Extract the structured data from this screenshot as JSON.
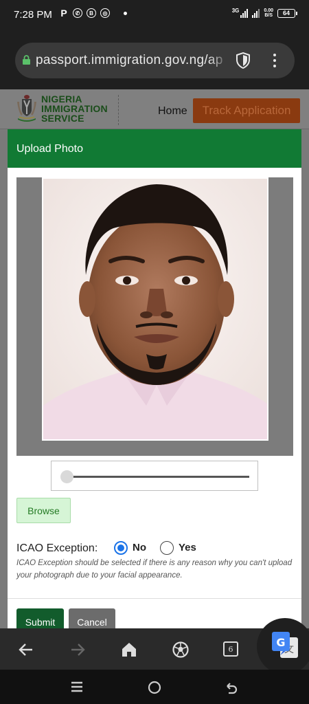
{
  "status_bar": {
    "time": "7:28 PM",
    "notification_icons": [
      "paypal-icon",
      "whatsapp-icon",
      "b-icon",
      "chrome-icon"
    ],
    "network_label": "3G",
    "speed_value": "0.00",
    "speed_unit": "B/S",
    "battery": "64"
  },
  "browser": {
    "url": "passport.immigration.gov.ng/ap",
    "tabs_count": "6"
  },
  "site": {
    "logo_line1": "NIGERIA",
    "logo_line2": "IMMIGRATION",
    "logo_line3": "SERVICE",
    "nav_home": "Home",
    "nav_track": "Track Application"
  },
  "modal": {
    "title": "Upload Photo",
    "zoom_level": 0,
    "browse_label": "Browse",
    "icao_label": "ICAO Exception:",
    "option_no": "No",
    "option_yes": "Yes",
    "selected_option": "No",
    "icao_note": "ICAO Exception should be selected if there is any reason why you can't upload your photograph due to your facial appearance.",
    "submit_label": "Submit",
    "cancel_label": "Cancel"
  },
  "colors": {
    "modal_header": "#117a34",
    "submit": "#125c2c",
    "track_button": "#8a3a10",
    "radio_selected": "#1a73e8"
  }
}
